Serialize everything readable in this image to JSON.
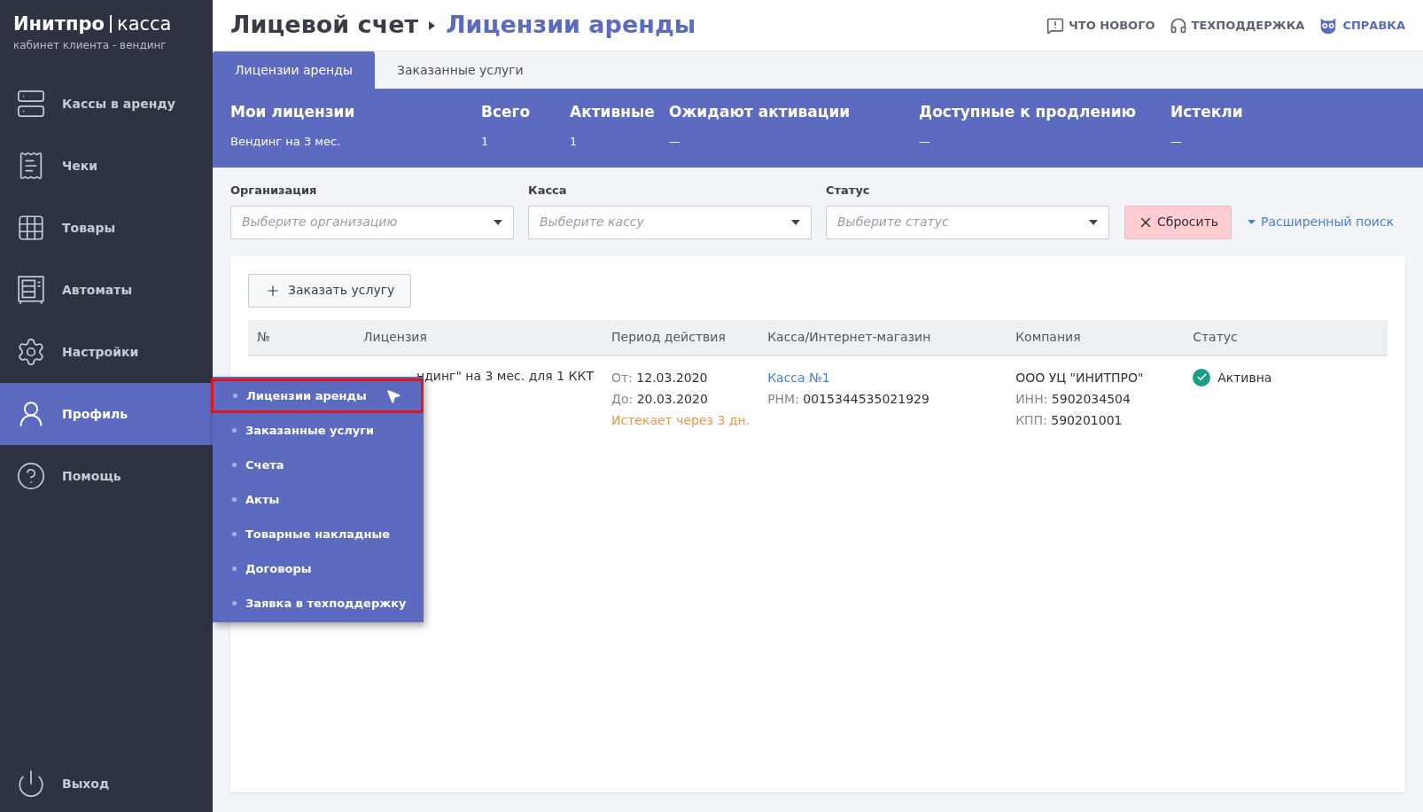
{
  "brand": {
    "name": "Инитпро",
    "product": "касса",
    "subtitle": "кабинет клиента - вендинг"
  },
  "sidebar": {
    "items": [
      {
        "kind": "server",
        "label": "Кассы в аренду",
        "selected": false
      },
      {
        "kind": "receipt",
        "label": "Чеки",
        "selected": false
      },
      {
        "kind": "grid",
        "label": "Товары",
        "selected": false
      },
      {
        "kind": "vending",
        "label": "Автоматы",
        "selected": false
      },
      {
        "kind": "gear",
        "label": "Настройки",
        "selected": false
      },
      {
        "kind": "user",
        "label": "Профиль",
        "selected": true
      },
      {
        "kind": "help",
        "label": "Помощь",
        "selected": false
      }
    ],
    "logout": "Выход"
  },
  "submenu": {
    "items": [
      {
        "label": "Лицензии аренды",
        "selected": true
      },
      {
        "label": "Заказанные услуги",
        "selected": false
      },
      {
        "label": "Счета",
        "selected": false
      },
      {
        "label": "Акты",
        "selected": false
      },
      {
        "label": "Товарные накладные",
        "selected": false
      },
      {
        "label": "Договоры",
        "selected": false
      },
      {
        "label": "Заявка в техподдержку",
        "selected": false
      }
    ]
  },
  "breadcrumb": {
    "parent": "Лицевой счет",
    "current": "Лицензии аренды"
  },
  "header_links": [
    {
      "kind": "news",
      "label": "ЧТО НОВОГО"
    },
    {
      "kind": "support",
      "label": "ТЕХПОДДЕРЖКА"
    },
    {
      "kind": "help",
      "label": "СПРАВКА"
    }
  ],
  "tabs": [
    {
      "label": "Лицензии аренды",
      "selected": true
    },
    {
      "label": "Заказанные услуги",
      "selected": false
    }
  ],
  "summary": [
    {
      "title": "Мои лицензии",
      "value": "Вендинг на 3 мес."
    },
    {
      "title": "Всего",
      "value": "1"
    },
    {
      "title": "Активные",
      "value": "1"
    },
    {
      "title": "Ожидают активации",
      "value": "—"
    },
    {
      "title": "Доступные к продлению",
      "value": "—"
    },
    {
      "title": "Истекли",
      "value": "—"
    }
  ],
  "filters": [
    {
      "label": "Организация",
      "placeholder": "Выберите организацию"
    },
    {
      "label": "Касса",
      "placeholder": "Выберите кассу"
    },
    {
      "label": "Статус",
      "placeholder": "Выберите статус"
    }
  ],
  "reset_button": "Сбросить",
  "advanced_search": "Расширенный поиск",
  "order_button": "Заказать услугу",
  "table": {
    "columns": [
      "№",
      "Лицензия",
      "Период действия",
      "Касса/Интернет-магазин",
      "Компания",
      "Статус"
    ],
    "rows": [
      {
        "license": "ндинг\" на 3 мес. для 1 ККТ",
        "from_label": "От:",
        "from": "12.03.2020",
        "to_label": "До:",
        "to": "20.03.2020",
        "expires": "Истекает через 3 дн.",
        "kassa": "Касса №1",
        "rnm_label": "РНМ:",
        "rnm": "0015344535021929",
        "company": "ООО УЦ \"ИНИТПРО\"",
        "inn_label": "ИНН:",
        "inn": "5902034504",
        "kpp_label": "КПП:",
        "kpp": "590201001",
        "status": "Активна",
        "active": true
      }
    ]
  }
}
